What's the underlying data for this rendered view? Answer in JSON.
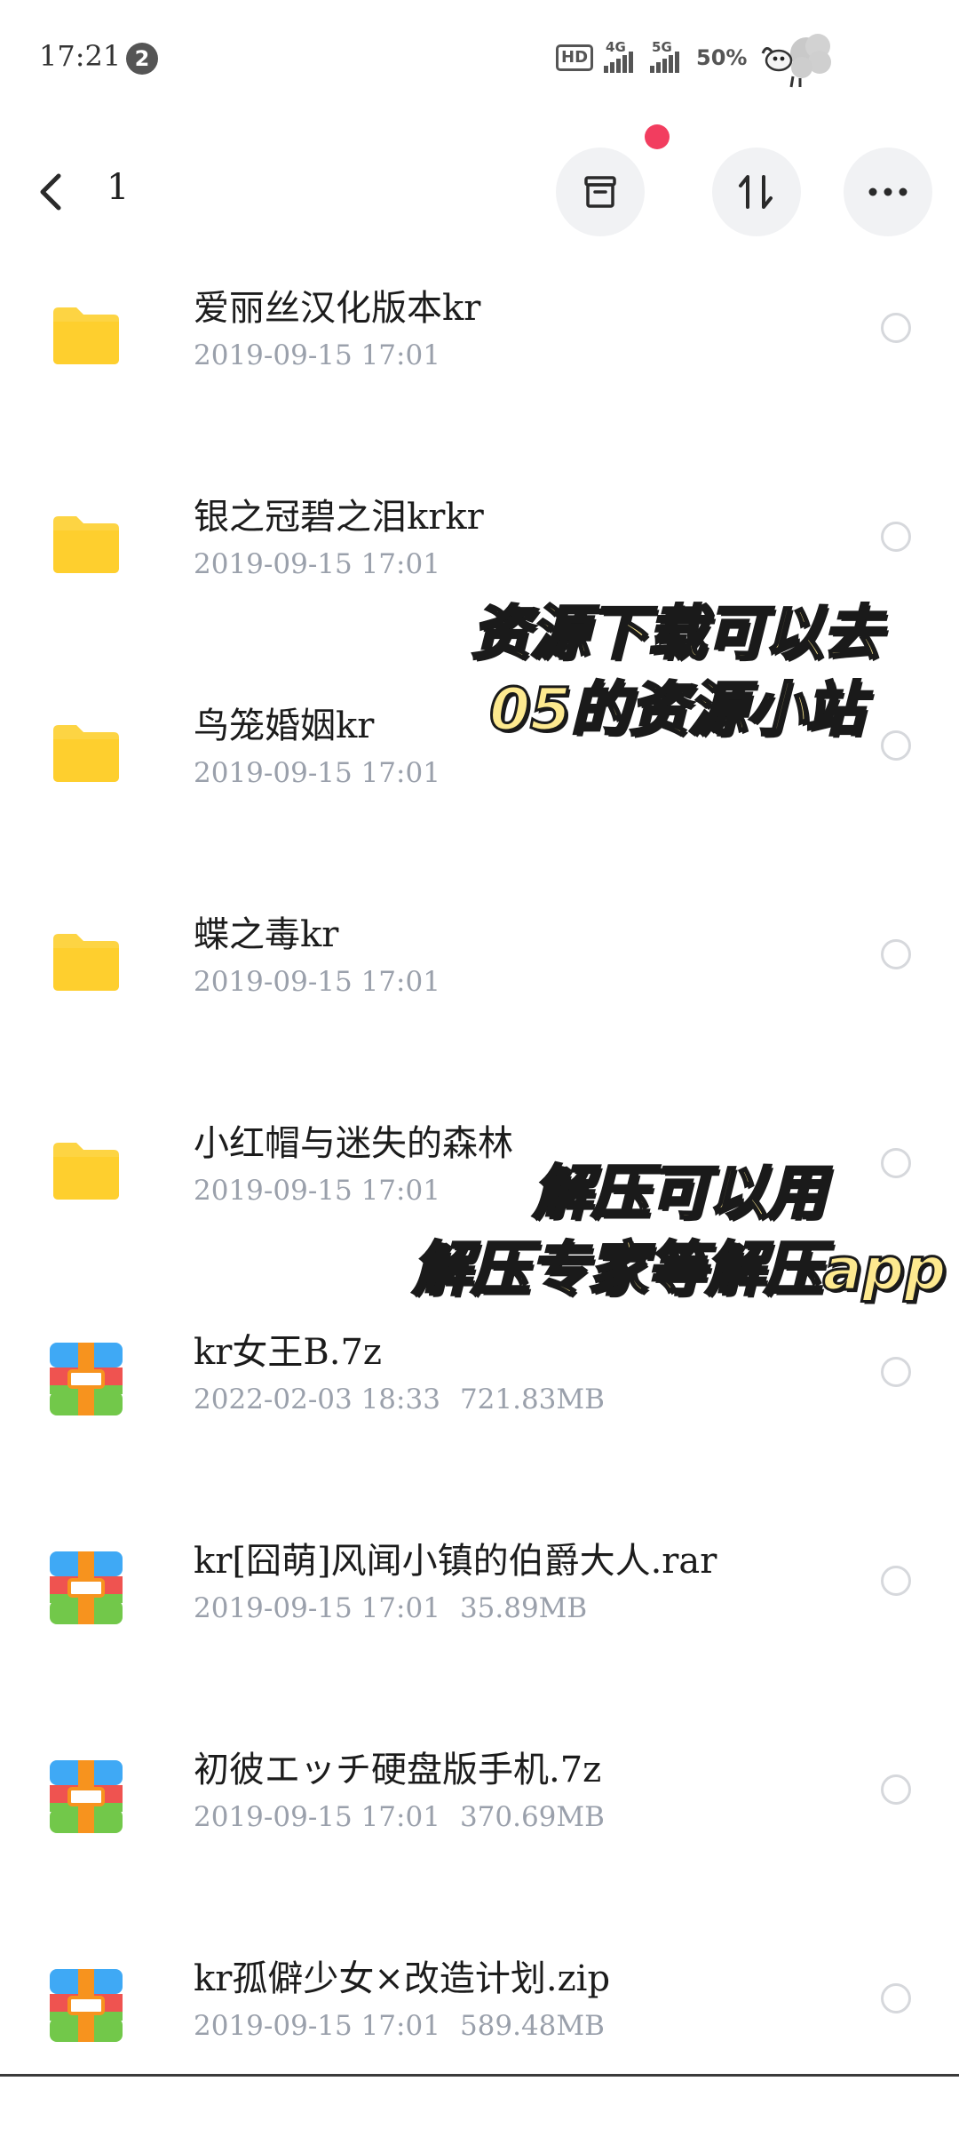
{
  "status_bar": {
    "time": "17:21",
    "notification_count": "2",
    "hd_label": "HD",
    "network_1": "4G",
    "network_2": "5G",
    "battery": "50%"
  },
  "nav": {
    "title": "1"
  },
  "files": [
    {
      "name": "爱丽丝汉化版本kr",
      "date": "2019-09-15 17:01",
      "size": "",
      "type": "folder"
    },
    {
      "name": "银之冠碧之泪krkr",
      "date": "2019-09-15 17:01",
      "size": "",
      "type": "folder"
    },
    {
      "name": "鸟笼婚姻kr",
      "date": "2019-09-15 17:01",
      "size": "",
      "type": "folder"
    },
    {
      "name": "蝶之毒kr",
      "date": "2019-09-15 17:01",
      "size": "",
      "type": "folder"
    },
    {
      "name": "小红帽与迷失的森林",
      "date": "2019-09-15 17:01",
      "size": "",
      "type": "folder"
    },
    {
      "name": "kr女王B.7z",
      "date": "2022-02-03 18:33",
      "size": "721.83MB",
      "type": "archive"
    },
    {
      "name": "kr[囧萌]风闻小镇的伯爵大人.rar",
      "date": "2019-09-15 17:01",
      "size": "35.89MB",
      "type": "archive"
    },
    {
      "name": "初彼エッチ硬盘版手机.7z",
      "date": "2019-09-15 17:01",
      "size": "370.69MB",
      "type": "archive"
    },
    {
      "name": "kr孤僻少女×改造计划.zip",
      "date": "2019-09-15 17:01",
      "size": "589.48MB",
      "type": "archive"
    }
  ],
  "overlay": {
    "caption_1_line_1": "资源下载可以去",
    "caption_1_line_2": "05的资源小站",
    "caption_2_line_1": "解压可以用",
    "caption_2_line_2": "解压专家等解压app"
  },
  "colors": {
    "folder": "#fdd443",
    "archive_blue": "#3fa9f5",
    "archive_red": "#ef5350",
    "archive_green": "#72c84a",
    "archive_strap": "#f7931e",
    "accent_dot": "#f23d5f",
    "meta_text": "#9aa0ab"
  },
  "icons": {
    "back": "chevron-left-icon",
    "box": "archive-box-icon",
    "sort": "sort-icon",
    "more": "more-horizontal-icon",
    "folder": "folder-icon",
    "archive": "archive-file-icon"
  }
}
